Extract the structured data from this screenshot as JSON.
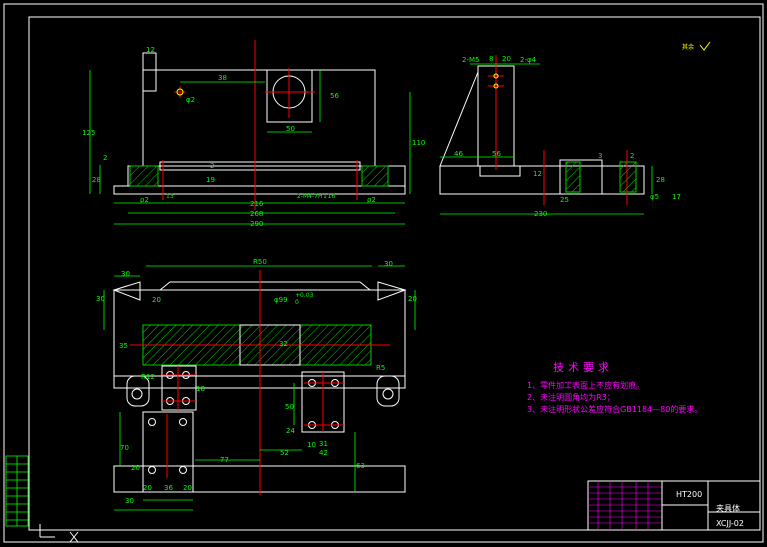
{
  "colors": {
    "outline": "#ffffff",
    "dim": "#00ff00",
    "center": "#ff0000",
    "hatch": "#00cc00",
    "note": "#ff00ff",
    "title_block": "#ff00ff",
    "tb_grid": "#00ff00"
  },
  "front_view": {
    "dims": [
      "12",
      "38",
      "φ2",
      "56",
      "50",
      "125",
      "110",
      "2",
      "28",
      "19",
      "2",
      "ρ2",
      "216",
      "268",
      "290",
      "2-M4-7H↓16",
      "ρ2",
      "13"
    ]
  },
  "side_view": {
    "dims": [
      "2-M5",
      "8",
      "20",
      "2-φ4",
      "46",
      "56",
      "12",
      "2",
      "28",
      "230",
      "3",
      "φ5",
      "17",
      "25"
    ]
  },
  "top_view": {
    "dims": [
      "R50",
      "30",
      "30",
      "30",
      "20",
      "20",
      "φ99",
      "+0.03",
      "0",
      "35",
      "32",
      "R12",
      "R5",
      "18",
      "50",
      "24",
      "10",
      "31",
      "42",
      "52",
      "77",
      "63",
      "70",
      "20",
      "36",
      "30",
      "20",
      "20"
    ]
  },
  "tech_req": {
    "title": "技术要求",
    "items": [
      "1、零件加工表面上不应有划痕。",
      "2、未注明圆角均为R3；",
      "3、未注明形状公差应符合GB1184—80的要求。"
    ]
  },
  "title_block": {
    "material": "HT200",
    "part_name": "夹具体",
    "drawing_no": "XCJJ-02"
  },
  "roughness_mark": "其余"
}
